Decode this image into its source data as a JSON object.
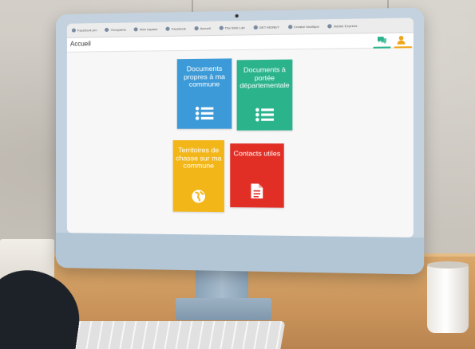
{
  "browser": {
    "bookmarks": [
      {
        "label": "Facebook pro"
      },
      {
        "label": "Groupama"
      },
      {
        "label": "Mon espace"
      },
      {
        "label": "Facebook"
      },
      {
        "label": "Accueil"
      },
      {
        "label": "The Web Lab"
      },
      {
        "label": "GET MONEY"
      },
      {
        "label": "Creator boutique"
      },
      {
        "label": "Adobe Express"
      }
    ]
  },
  "app": {
    "title": "Accueil",
    "accent_green": "#2bb38c",
    "accent_orange": "#f0a516"
  },
  "tiles": [
    {
      "label": "Documents propres à ma commune",
      "color": "#3c9ad8",
      "icon": "list-icon"
    },
    {
      "label": "Documents à portée départementale",
      "color": "#2bb38c",
      "icon": "list-icon"
    },
    {
      "label": "Territoires de chasse sur ma commune",
      "color": "#f2b619",
      "icon": "globe-icon"
    },
    {
      "label": "Contacts utiles",
      "color": "#e12f26",
      "icon": "document-icon"
    }
  ]
}
